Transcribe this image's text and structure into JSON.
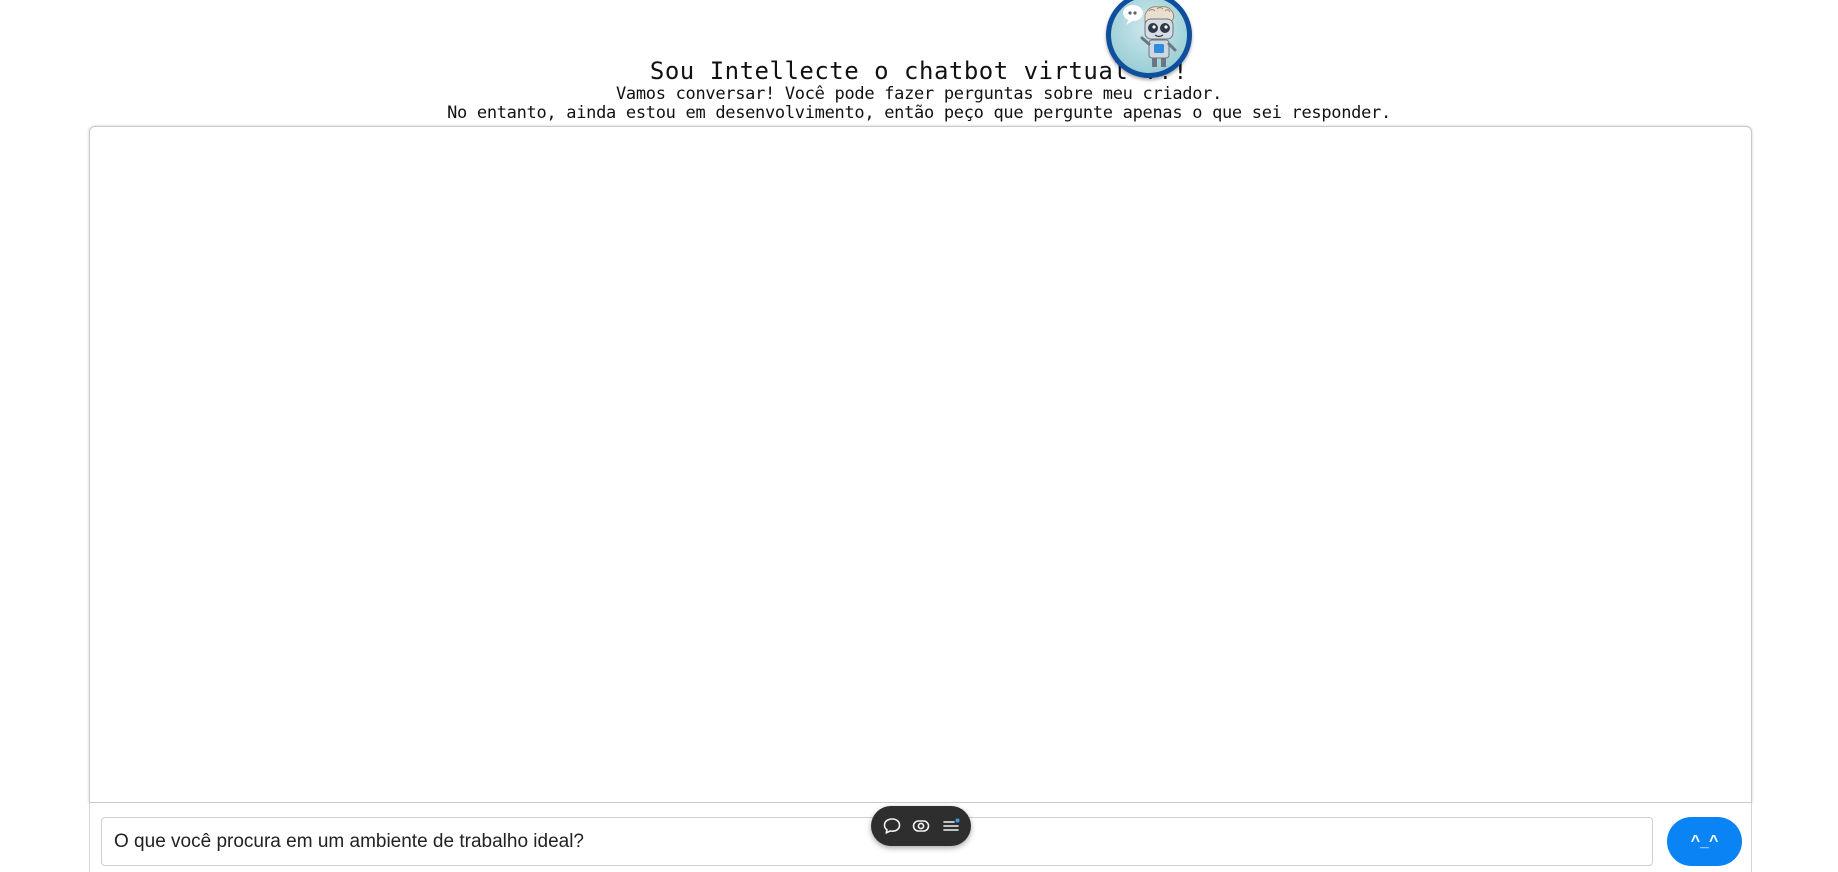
{
  "header": {
    "title": "Sou Intellecte o chatbot virtual !!!",
    "subtitle_line1": "Vamos conversar! Você pode fazer perguntas sobre meu criador.",
    "subtitle_line2": "No entanto, ainda estou em desenvolvimento, então peço que pergunte apenas o que sei responder.",
    "avatar_icon": "robot-avatar-icon"
  },
  "chat": {
    "messages": []
  },
  "input": {
    "value": "O que você procura em um ambiente de trabalho ideal?",
    "send_label": "^_^"
  },
  "toolbar": {
    "icons": [
      "chat-bubble-icon",
      "eye-icon",
      "list-icon"
    ]
  },
  "colors": {
    "send_button": "#0a84f5",
    "avatar_ring": "#0d4f9c",
    "toolbar_bg": "#2e2e2e"
  }
}
